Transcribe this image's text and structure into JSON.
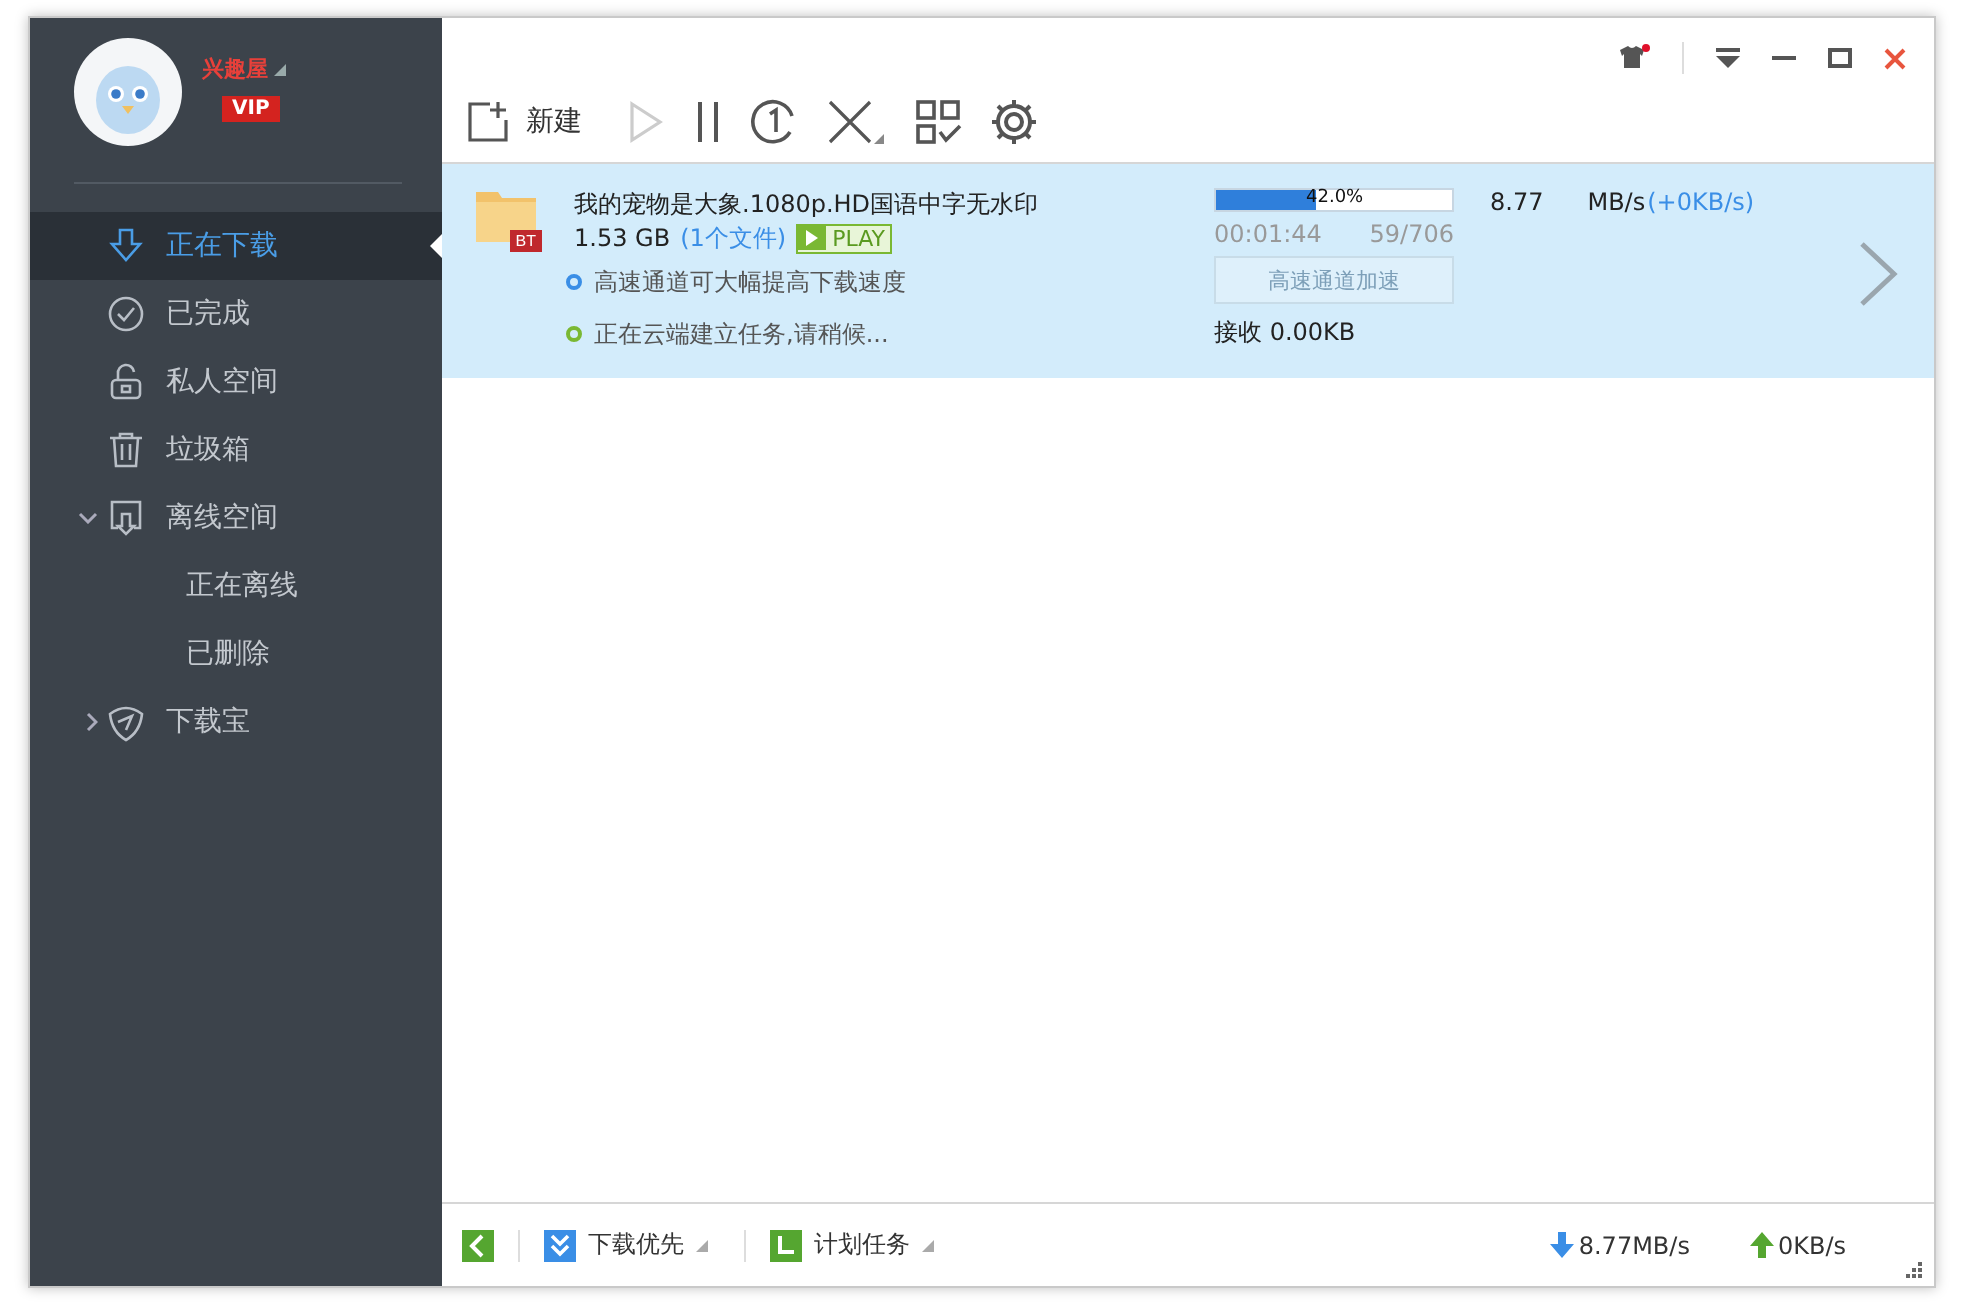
{
  "user": {
    "name": "兴趣屋",
    "badge": "VIP"
  },
  "sidebar": {
    "items": [
      {
        "label": "正在下载",
        "selected": true
      },
      {
        "label": "已完成",
        "selected": false
      },
      {
        "label": "私人空间",
        "selected": false
      },
      {
        "label": "垃圾箱",
        "selected": false
      },
      {
        "label": "离线空间",
        "selected": false,
        "expanded": true,
        "children": [
          {
            "label": "正在离线",
            "selected": false
          },
          {
            "label": "已删除",
            "selected": false
          }
        ]
      },
      {
        "label": "下载宝",
        "selected": false,
        "expanded": false
      }
    ]
  },
  "toolbar": {
    "new_label": "新建",
    "play_disabled": true
  },
  "task": {
    "tag": "BT",
    "name": "我的宠物是大象.1080p.HD国语中字无水印",
    "size": "1.53 GB",
    "files": "(1个文件)",
    "play": "PLAY",
    "hints": [
      {
        "text": "高速通道可大幅提高下载速度",
        "color": "#3a8ee6"
      },
      {
        "text": "正在云端建立任务,请稍候...",
        "color": "#7ab833"
      }
    ],
    "level": 0.42,
    "percent": "42.0%",
    "elapsed": "00:01:44",
    "pieces": "59/706",
    "accel": {
      "label": "高速通道加速",
      "disabled": true
    },
    "received": "接收 0.00KB",
    "speed": "8.77",
    "unit": "MB/s",
    "extra": "(+0KB/s)"
  },
  "status_bar": {
    "priority": "下载优先",
    "schedule": "计划任务",
    "down": "8.77MB/s",
    "up": "0KB/s"
  }
}
